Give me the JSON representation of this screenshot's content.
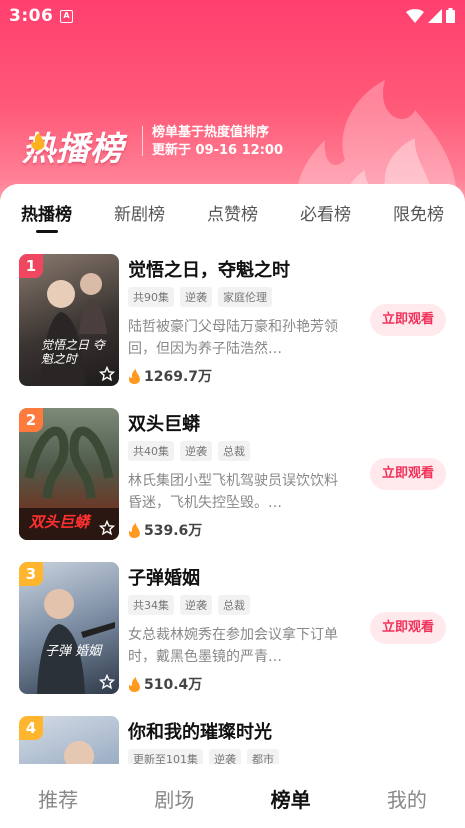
{
  "status_bar": {
    "time": "3:06",
    "app_icon": "A"
  },
  "banner": {
    "title": "热播榜",
    "subtitle_line1": "榜单基于热度值排序",
    "subtitle_line2": "更新于 09-16 12:00"
  },
  "tabs": [
    {
      "label": "热播榜",
      "active": true
    },
    {
      "label": "新剧榜",
      "active": false
    },
    {
      "label": "点赞榜",
      "active": false
    },
    {
      "label": "必看榜",
      "active": false
    },
    {
      "label": "限免榜",
      "active": false
    }
  ],
  "items": [
    {
      "rank": "1",
      "rank_color": "#f0465f",
      "title": "觉悟之日，夺魁之时",
      "tags": [
        "共90集",
        "逆袭",
        "家庭伦理"
      ],
      "desc": "陆哲被豪门父母陆万豪和孙艳芳领回，但因为养子陆浩然…",
      "heat": "1269.7万",
      "cover_text": "觉悟之日 夺魁之时",
      "button": "立即观看"
    },
    {
      "rank": "2",
      "rank_color": "#ff7a3d",
      "title": "双头巨蟒",
      "tags": [
        "共40集",
        "逆袭",
        "总裁"
      ],
      "desc": "林氏集团小型飞机驾驶员误饮饮料昏迷，飞机失控坠毁。…",
      "heat": "539.6万",
      "cover_text": "双头巨蟒",
      "button": "立即观看"
    },
    {
      "rank": "3",
      "rank_color": "#ffb52e",
      "title": "子弹婚姻",
      "tags": [
        "共34集",
        "逆袭",
        "总裁"
      ],
      "desc": "女总裁林婉秀在参加会议拿下订单时，戴黑色墨镜的严青…",
      "heat": "510.4万",
      "cover_text": "子弹 婚姻",
      "button": "立即观看"
    },
    {
      "rank": "4",
      "rank_color": "#ffb52e",
      "title": "你和我的璀璨时光",
      "tags": [
        "更新至101集",
        "逆袭",
        "都市"
      ],
      "desc": "",
      "heat": "",
      "cover_text": "",
      "button": ""
    }
  ],
  "bottom_nav": [
    {
      "label": "推荐",
      "active": false
    },
    {
      "label": "剧场",
      "active": false
    },
    {
      "label": "榜单",
      "active": true
    },
    {
      "label": "我的",
      "active": false
    }
  ],
  "colors": {
    "accent": "#f1315a",
    "header_top": "#ff3f6f"
  },
  "icons": [
    "wifi-icon",
    "signal-icon",
    "battery-icon",
    "flame-icon",
    "star-icon"
  ]
}
